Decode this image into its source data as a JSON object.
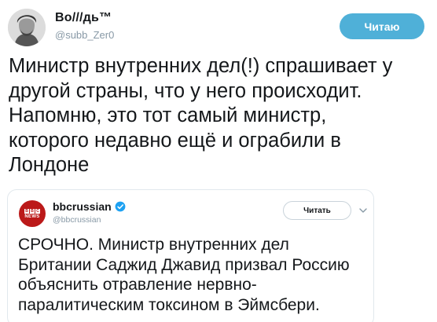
{
  "author": {
    "display_name": "Во///дь™",
    "username": "@subb_Zer0",
    "avatar_icon": "portrait-avatar"
  },
  "follow_button": {
    "label": "Читаю"
  },
  "tweet": {
    "text": "Министр внутренних дел(!) спрашивает у\nдругой страны, что у него происходит.\nНапомню, это тот самый министр,\nкоторого недавно ещё и ограбили в\nЛондоне"
  },
  "quoted": {
    "logo": {
      "blocks": [
        "B",
        "B",
        "C"
      ],
      "news": "NEWS",
      "color": "#bb1919"
    },
    "display_name": "bbcrussian",
    "verified": true,
    "handle": "@bbcrussian",
    "follow_label": "Читать",
    "menu_icon": "chevron-down-icon",
    "text": "СРОЧНО.  Министр внутренних дел\nБритании Саджид Джавид призвал Россию\nобъяснить отравление нервно-\nпаралитическим токсином в Эймсбери."
  },
  "colors": {
    "accent": "#4fb0d8",
    "verified": "#1da1f2",
    "secondary_text": "#8899a6",
    "border": "#e1e8ed"
  }
}
